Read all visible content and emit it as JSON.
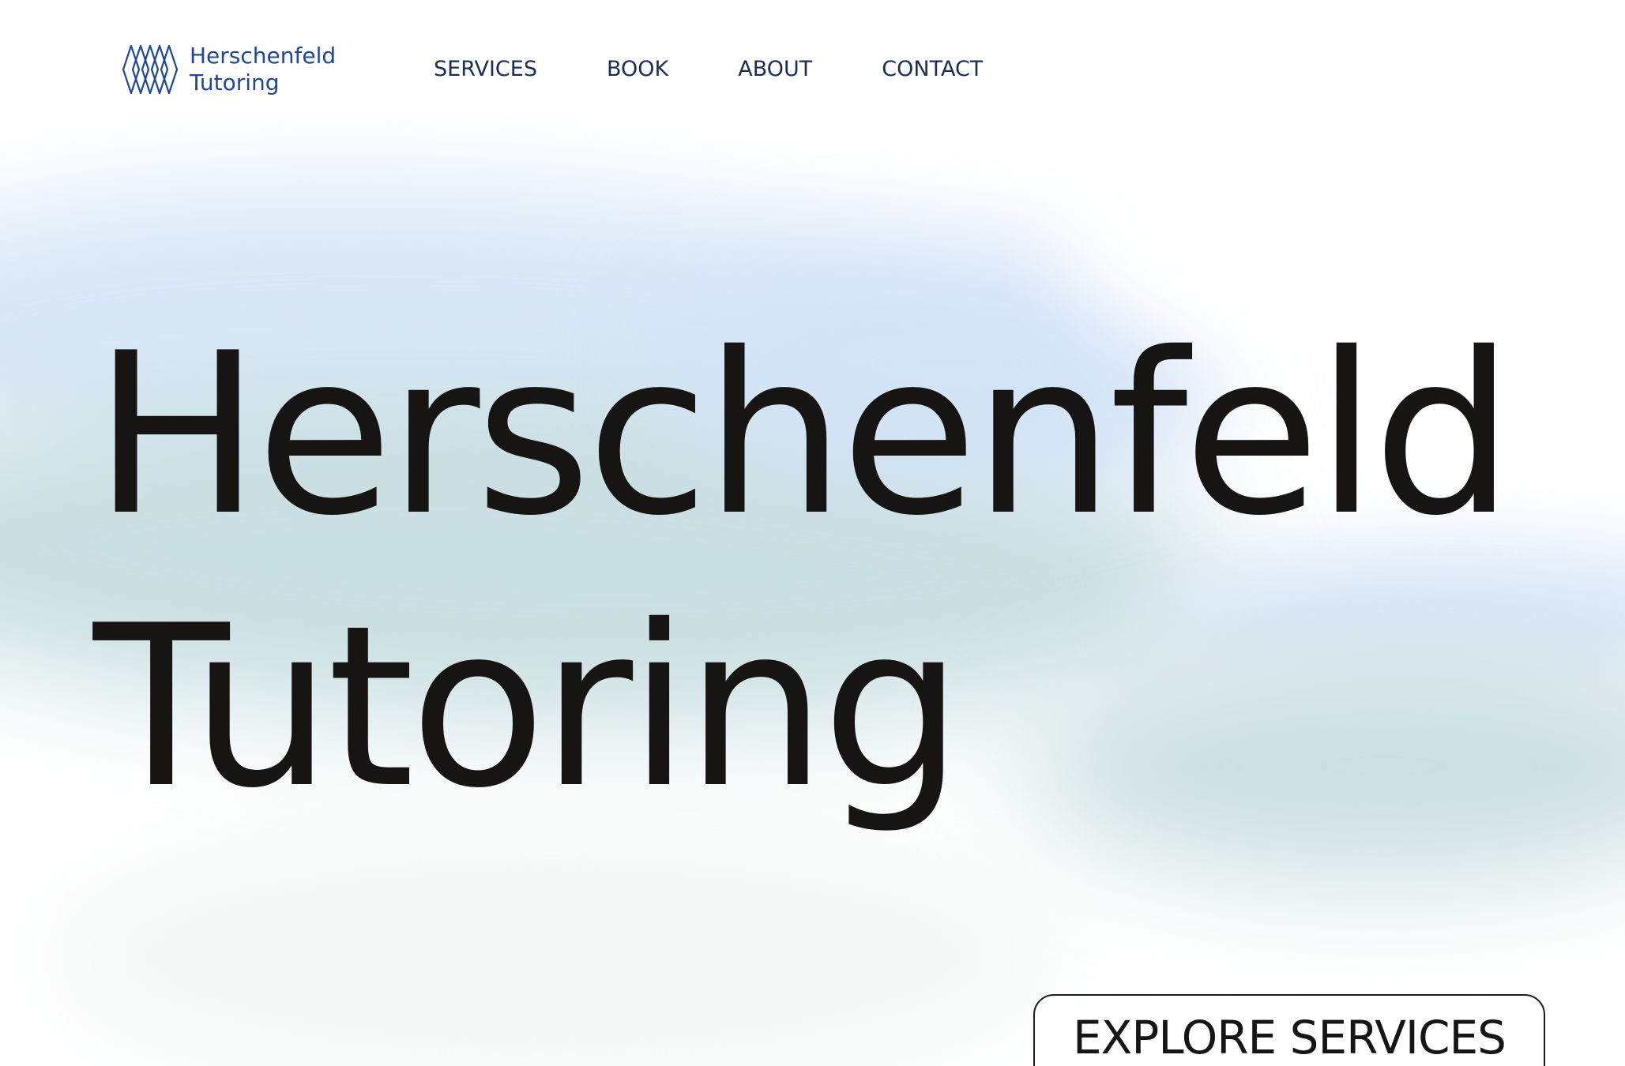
{
  "brand": {
    "name_line1": "Herschenfeld",
    "name_line2": "Tutoring",
    "icon": "diamond-lattice-logo-icon",
    "color": "#1f4796"
  },
  "nav": {
    "items": [
      {
        "label": "SERVICES"
      },
      {
        "label": "BOOK"
      },
      {
        "label": "ABOUT"
      },
      {
        "label": "CONTACT"
      }
    ]
  },
  "hero": {
    "title_line1": "Herschenfeld",
    "title_line2": "Tutoring",
    "cta_label": "EXPLORE SERVICES"
  },
  "colors": {
    "text": "#161514",
    "nav_text": "#1b2e52",
    "background_blue": "#d9e7f7",
    "background_teal": "#cadfe1"
  }
}
